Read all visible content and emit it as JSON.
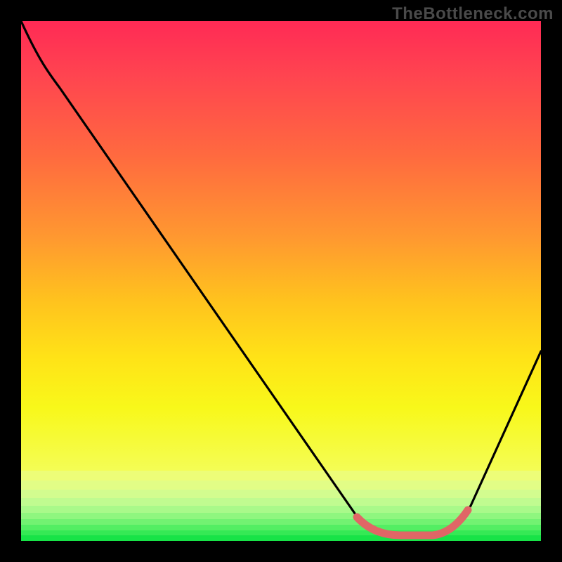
{
  "watermark": "TheBottleneck.com",
  "chart_data": {
    "type": "line",
    "title": "",
    "xlabel": "",
    "ylabel": "",
    "xlim": [
      0,
      1
    ],
    "ylim": [
      0,
      1
    ],
    "grid": false,
    "legend": false,
    "series": [
      {
        "name": "bottleneck-curve",
        "color": "#000000",
        "x": [
          0.0,
          0.05,
          0.1,
          0.2,
          0.3,
          0.4,
          0.5,
          0.6,
          0.65,
          0.7,
          0.75,
          0.8,
          0.85,
          0.9,
          1.0
        ],
        "y": [
          1.0,
          0.9,
          0.85,
          0.7,
          0.55,
          0.4,
          0.26,
          0.1,
          0.04,
          0.01,
          0.01,
          0.02,
          0.07,
          0.18,
          0.37
        ]
      },
      {
        "name": "optimal-range-highlight",
        "color": "#e06666",
        "x": [
          0.65,
          0.7,
          0.75,
          0.8,
          0.85
        ],
        "y": [
          0.04,
          0.01,
          0.01,
          0.02,
          0.07
        ]
      }
    ],
    "background_gradient": {
      "orientation": "vertical",
      "stops": [
        {
          "pos": 0.0,
          "color": "#ff2a55"
        },
        {
          "pos": 0.3,
          "color": "#ff6a3f"
        },
        {
          "pos": 0.6,
          "color": "#ffc21e"
        },
        {
          "pos": 0.82,
          "color": "#f8f81a"
        },
        {
          "pos": 1.0,
          "color": "#17e347"
        }
      ],
      "banded_bottom_fraction": 0.14
    },
    "annotations": [
      {
        "text": "TheBottleneck.com",
        "role": "watermark",
        "position": "top-right",
        "color": "#4a4a4a"
      }
    ]
  }
}
